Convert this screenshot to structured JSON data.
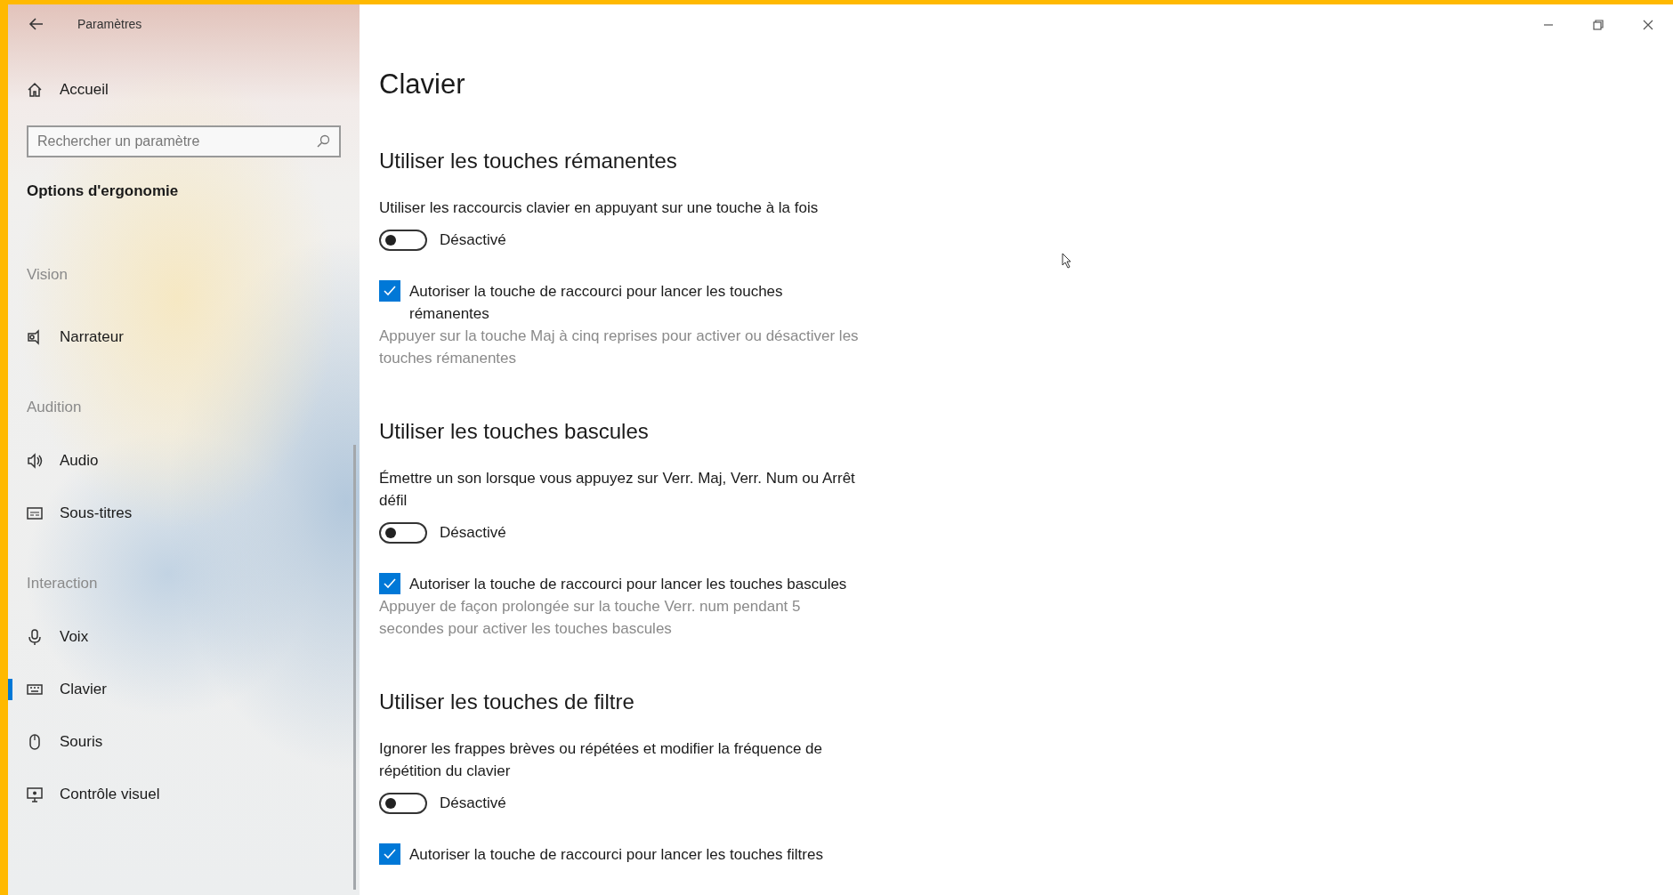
{
  "window": {
    "title": "Paramètres"
  },
  "sidebar": {
    "home": "Accueil",
    "search": {
      "placeholder": "Rechercher un paramètre"
    },
    "category": "Options d'ergonomie",
    "groups": [
      {
        "label": "Vision",
        "items": [
          {
            "label": "Narrateur",
            "kind": "narrator",
            "selected": false
          }
        ]
      },
      {
        "label": "Audition",
        "items": [
          {
            "label": "Audio",
            "kind": "speaker",
            "selected": false
          },
          {
            "label": "Sous-titres",
            "kind": "captions",
            "selected": false
          }
        ]
      },
      {
        "label": "Interaction",
        "items": [
          {
            "label": "Voix",
            "kind": "microphone",
            "selected": false
          },
          {
            "label": "Clavier",
            "kind": "keyboard",
            "selected": true
          },
          {
            "label": "Souris",
            "kind": "mouse",
            "selected": false
          },
          {
            "label": "Contrôle visuel",
            "kind": "monitor",
            "selected": false
          }
        ]
      }
    ]
  },
  "page": {
    "title": "Clavier",
    "sections": [
      {
        "heading": "Utiliser les touches rémanentes",
        "description": "Utiliser les raccourcis clavier en appuyant sur une touche à la fois",
        "toggle": {
          "on": false,
          "label": "Désactivé"
        },
        "checkbox": {
          "checked": true,
          "label": "Autoriser la touche de raccourci pour lancer les touches rémanentes"
        },
        "hint": "Appuyer sur la touche Maj à cinq reprises pour activer ou désactiver les touches rémanentes"
      },
      {
        "heading": "Utiliser les touches bascules",
        "description": "Émettre un son lorsque vous appuyez sur Verr. Maj, Verr. Num ou Arrêt défil",
        "toggle": {
          "on": false,
          "label": "Désactivé"
        },
        "checkbox": {
          "checked": true,
          "label": "Autoriser la touche de raccourci pour lancer les touches bascules"
        },
        "hint": "Appuyer de façon prolongée sur la touche Verr. num pendant 5 secondes pour activer les touches bascules"
      },
      {
        "heading": "Utiliser les touches de filtre",
        "description": "Ignorer les frappes brèves ou répétées et modifier la fréquence de répétition du clavier",
        "toggle": {
          "on": false,
          "label": "Désactivé"
        },
        "checkbox": {
          "checked": true,
          "label": "Autoriser la touche de raccourci pour lancer les touches filtres"
        }
      }
    ]
  }
}
